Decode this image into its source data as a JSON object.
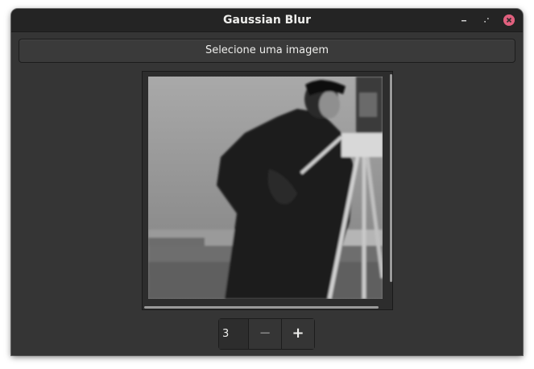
{
  "window": {
    "title": "Gaussian Blur",
    "controls": {
      "minimize_icon": "minimize-icon",
      "maximize_icon": "maximize-icon",
      "close_icon": "close-icon",
      "close_color": "#e0607e"
    }
  },
  "toolbar": {
    "select_image_label": "Selecione uma imagem"
  },
  "image_view": {
    "content": "grayscale-photo-cameraman"
  },
  "blur_spin": {
    "value": "3",
    "decrement_symbol": "−",
    "increment_symbol": "+"
  }
}
